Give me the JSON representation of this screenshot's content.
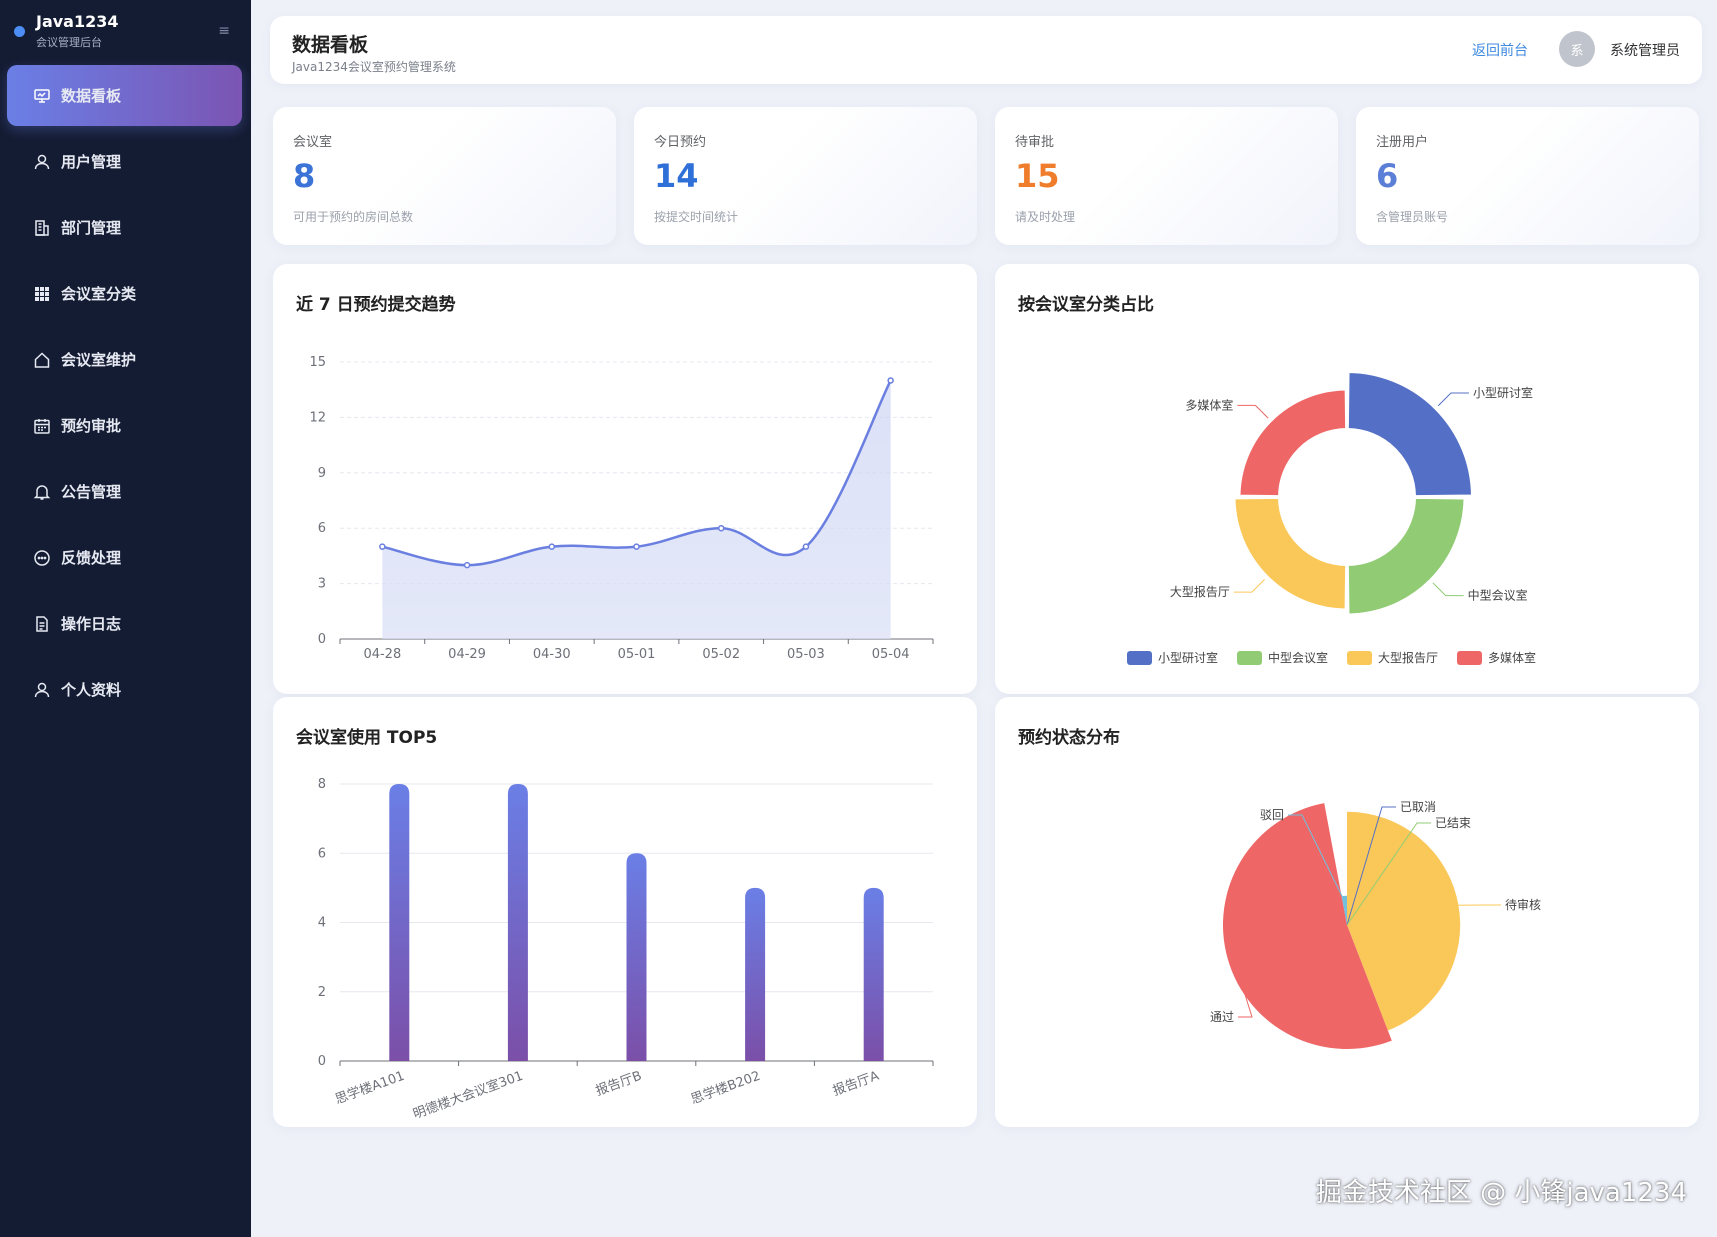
{
  "sidebar": {
    "brand_title": "Java1234",
    "brand_sub": "会议管理后台",
    "collapse_icon": "≡",
    "items": [
      {
        "label": "数据看板",
        "icon": "dashboard-icon",
        "active": true
      },
      {
        "label": "用户管理",
        "icon": "user-icon"
      },
      {
        "label": "部门管理",
        "icon": "building-icon"
      },
      {
        "label": "会议室分类",
        "icon": "grid-icon"
      },
      {
        "label": "会议室维护",
        "icon": "house-icon"
      },
      {
        "label": "预约审批",
        "icon": "calendar-icon"
      },
      {
        "label": "公告管理",
        "icon": "bell-icon"
      },
      {
        "label": "反馈处理",
        "icon": "chat-icon"
      },
      {
        "label": "操作日志",
        "icon": "document-icon"
      },
      {
        "label": "个人资料",
        "icon": "profile-icon"
      }
    ]
  },
  "header": {
    "title": "数据看板",
    "subtitle": "Java1234会议室预约管理系统",
    "back_link": "返回前台",
    "avatar_text": "系",
    "user_name": "系统管理员"
  },
  "stats": [
    {
      "label": "会议室",
      "value": "8",
      "desc": "可用于预约的房间总数",
      "color": "#3b73d6"
    },
    {
      "label": "今日预约",
      "value": "14",
      "desc": "按提交时间统计",
      "color": "#2f6fd8"
    },
    {
      "label": "待审批",
      "value": "15",
      "desc": "请及时处理",
      "color": "#ef7d2c"
    },
    {
      "label": "注册用户",
      "value": "6",
      "desc": "含管理员账号",
      "color": "#5b7fd6"
    }
  ],
  "panels": {
    "trend_title": "近 7 日预约提交趋势",
    "category_title": "按会议室分类占比",
    "top5_title": "会议室使用 TOP5",
    "status_title": "预约状态分布"
  },
  "chart_data": [
    {
      "type": "line",
      "title": "近 7 日预约提交趋势",
      "categories": [
        "04-28",
        "04-29",
        "04-30",
        "05-01",
        "05-02",
        "05-03",
        "05-04"
      ],
      "values": [
        5,
        4,
        5,
        5,
        6,
        5,
        14
      ],
      "ylim": [
        0,
        15
      ],
      "yticks": [
        0,
        3,
        6,
        9,
        12,
        15
      ],
      "area": true,
      "smooth": true,
      "color": "#6a7fe0"
    },
    {
      "type": "pie",
      "title": "按会议室分类占比",
      "donut": true,
      "rose": true,
      "labels": [
        "小型研讨室",
        "中型会议室",
        "大型报告厅",
        "多媒体室"
      ],
      "values": [
        2,
        2,
        2,
        2
      ],
      "radii": [
        1.0,
        0.94,
        0.9,
        0.86
      ],
      "colors": [
        "#5470c6",
        "#91cc75",
        "#fac858",
        "#ee6666"
      ],
      "legend": "bottom"
    },
    {
      "type": "bar",
      "title": "会议室使用 TOP5",
      "categories": [
        "思学楼A101",
        "明德楼大会议室301",
        "报告厅B",
        "思学楼B202",
        "报告厅A"
      ],
      "values": [
        8,
        8,
        6,
        5,
        5
      ],
      "ylim": [
        0,
        8
      ],
      "yticks": [
        0,
        2,
        4,
        6,
        8
      ],
      "gradient": [
        "#6a7fe6",
        "#7b4fa8"
      ]
    },
    {
      "type": "pie",
      "title": "预约状态分布",
      "rose": true,
      "labels": [
        "待审核",
        "通过",
        "驳回",
        "已取消",
        "已结束"
      ],
      "values": [
        15,
        18,
        1,
        0,
        0
      ],
      "colors": [
        "#fac858",
        "#ee6666",
        "#73c0de",
        "#5470c6",
        "#91cc75"
      ]
    }
  ],
  "watermark": "掘金技术社区 @ 小锋java1234"
}
